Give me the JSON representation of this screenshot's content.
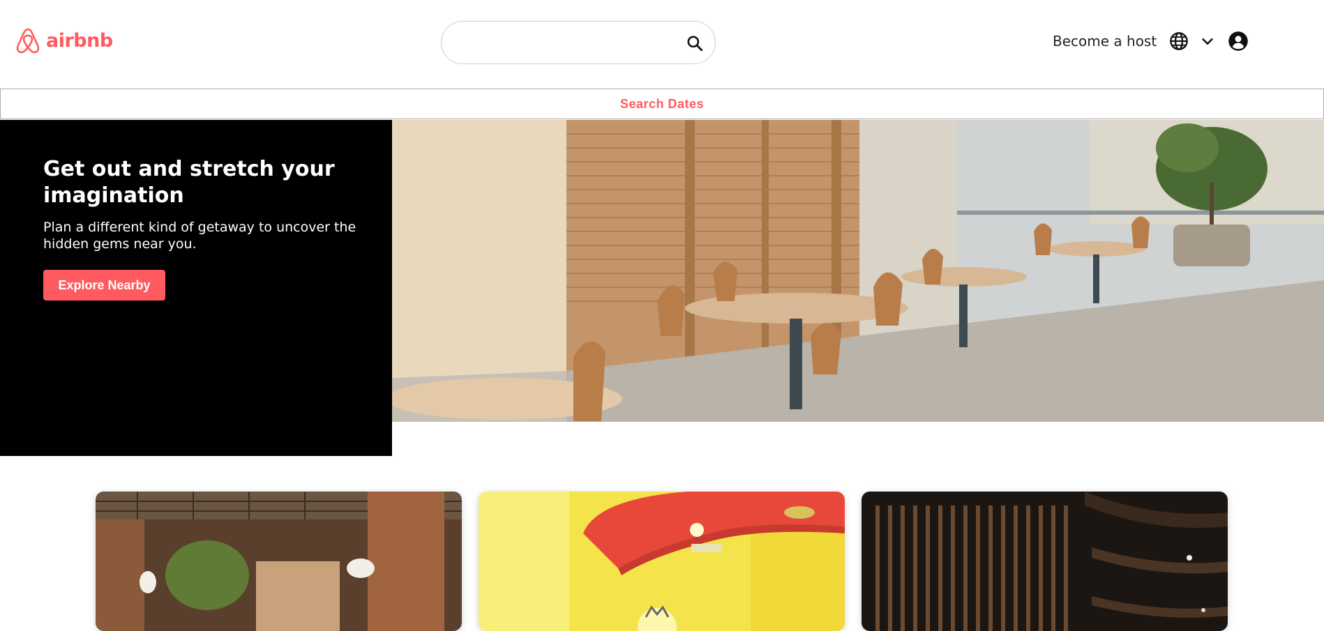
{
  "header": {
    "logo_text": "airbnb",
    "search": {
      "value": "",
      "placeholder": ""
    },
    "become_host_label": "Become a host",
    "icons": [
      "airbnb-logo-icon",
      "search-icon",
      "globe-icon",
      "chevron-down-icon",
      "user-account-icon"
    ]
  },
  "dates_bar": {
    "label": "Search Dates"
  },
  "hero": {
    "title": "Get out and stretch your imagination",
    "subtitle": "Plan a different kind of getaway to uncover the hidden gems near you.",
    "button_label": "Explore Nearby"
  },
  "cards": [
    {
      "image": "interior with brick pillars and potted plant"
    },
    {
      "image": "yellow room with red ceiling and chandelier"
    },
    {
      "image": "dark room with wooden slat walls"
    }
  ],
  "colors": {
    "brand": "#ff5a5f",
    "hero_panel": "#000000",
    "text": "#222222"
  }
}
